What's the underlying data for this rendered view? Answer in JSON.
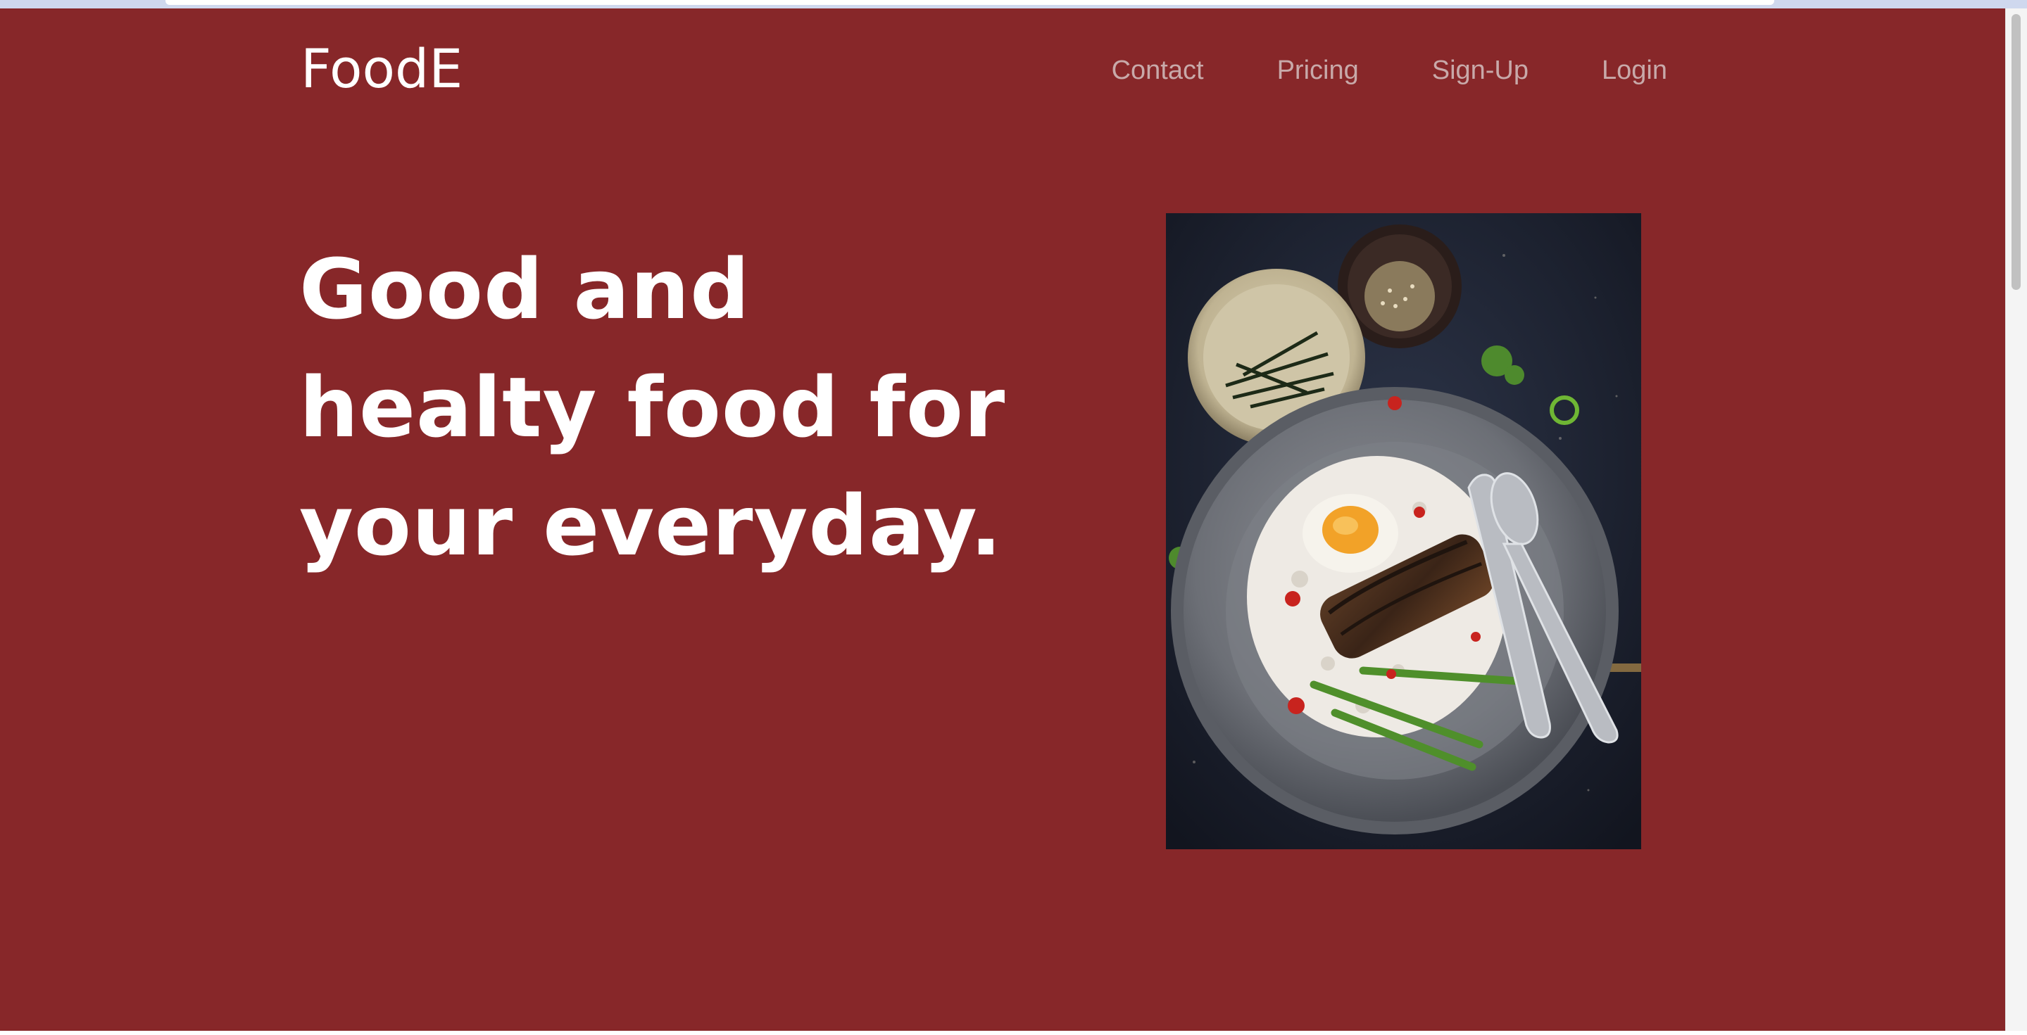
{
  "header": {
    "brand": "FoodE",
    "nav": [
      {
        "label": "Contact"
      },
      {
        "label": "Pricing"
      },
      {
        "label": "Sign-Up"
      },
      {
        "label": "Login"
      }
    ]
  },
  "hero": {
    "headline_lines": [
      "Good and",
      "healty food for",
      "your everyday."
    ],
    "image_icon": "food-plate-photo"
  },
  "colors": {
    "background": "#872729",
    "headline": "#ffffff",
    "brand": "#ffffff",
    "nav_link": "#c8a9a9"
  }
}
